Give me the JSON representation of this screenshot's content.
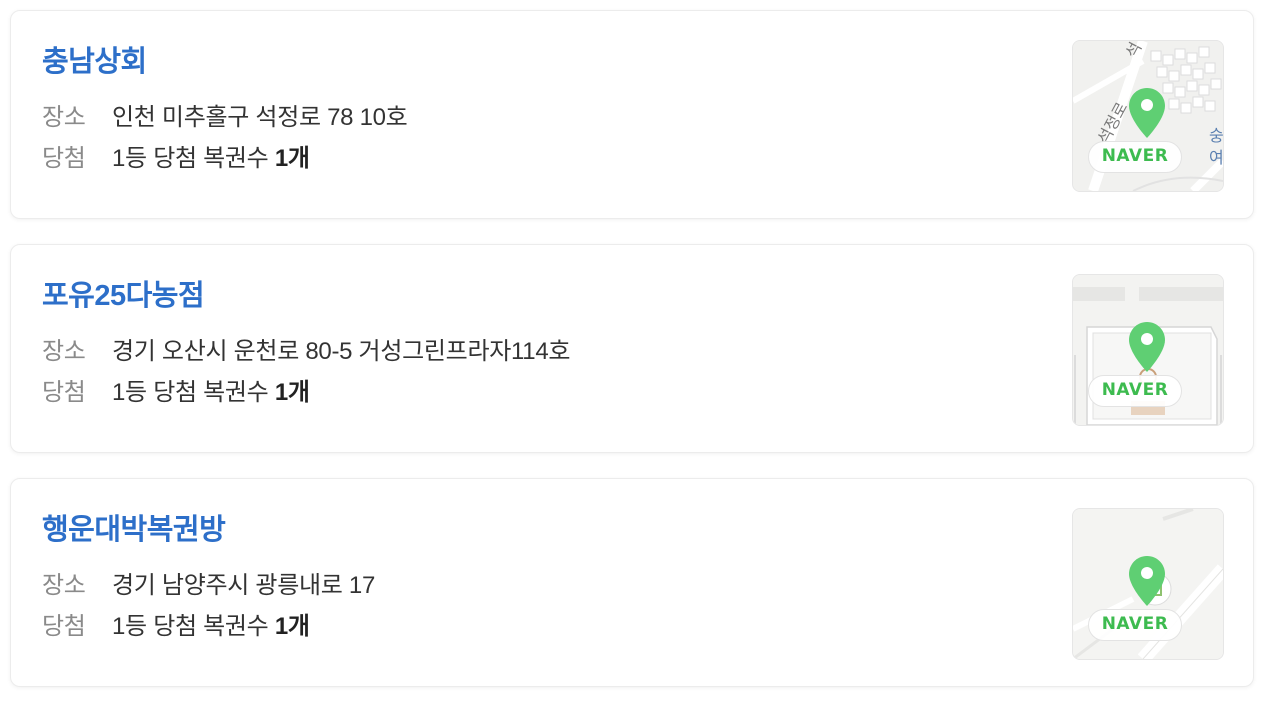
{
  "labels": {
    "location": "장소",
    "winning": "당첨"
  },
  "stores": [
    {
      "name": "충남상회",
      "address": "인천 미추홀구 석정로 78 10호",
      "win_text": "1등 당첨 복권수 ",
      "win_count": "1개",
      "map_badge": "NAVER",
      "map_labels": [
        "석정로",
        "석정로",
        "숭여",
        "석"
      ]
    },
    {
      "name": "포유25다농점",
      "address": "경기 오산시 운천로 80-5 거성그린프라자114호",
      "win_text": "1등 당첨 복권수 ",
      "win_count": "1개",
      "map_badge": "NAVER",
      "map_labels": []
    },
    {
      "name": "행운대박복권방",
      "address": "경기 남양주시 광릉내로 17",
      "win_text": "1등 당첨 복권수 ",
      "win_count": "1개",
      "map_badge": "NAVER",
      "map_labels": []
    }
  ],
  "colors": {
    "title": "#2d6fc9",
    "label": "#8a8a8a",
    "naver_green": "#3dbb4f",
    "pin": "#5fcf73"
  },
  "icons": {
    "pin": "map-pin-icon"
  }
}
